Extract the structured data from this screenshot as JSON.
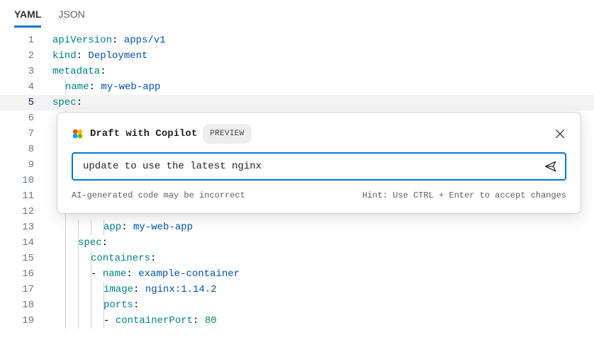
{
  "tabs": {
    "yaml": "YAML",
    "json": "JSON"
  },
  "editor": {
    "lines": [
      {
        "n": "1",
        "tokens": [
          {
            "t": "apiVersion",
            "c": "key"
          },
          {
            "t": ": ",
            "c": "punc"
          },
          {
            "t": "apps/v1",
            "c": "val"
          }
        ],
        "indent": 0
      },
      {
        "n": "2",
        "tokens": [
          {
            "t": "kind",
            "c": "key"
          },
          {
            "t": ": ",
            "c": "punc"
          },
          {
            "t": "Deployment",
            "c": "val"
          }
        ],
        "indent": 0
      },
      {
        "n": "3",
        "tokens": [
          {
            "t": "metadata",
            "c": "key"
          },
          {
            "t": ":",
            "c": "punc"
          }
        ],
        "indent": 0
      },
      {
        "n": "4",
        "tokens": [
          {
            "t": "name",
            "c": "key"
          },
          {
            "t": ": ",
            "c": "punc"
          },
          {
            "t": "my-web-app",
            "c": "val"
          }
        ],
        "indent": 1
      },
      {
        "n": "5",
        "tokens": [
          {
            "t": "spec",
            "c": "key"
          },
          {
            "t": ":",
            "c": "punc"
          }
        ],
        "indent": 0,
        "current": true
      },
      {
        "n": "6",
        "tokens": [],
        "indent": 1
      },
      {
        "n": "7",
        "tokens": [],
        "indent": 1
      },
      {
        "n": "8",
        "tokens": [],
        "indent": 1
      },
      {
        "n": "9",
        "tokens": [],
        "indent": 1
      },
      {
        "n": "10",
        "tokens": [],
        "indent": 1
      },
      {
        "n": "11",
        "tokens": [],
        "indent": 1
      },
      {
        "n": "12",
        "tokens": [],
        "indent": 1
      },
      {
        "n": "13",
        "tokens": [
          {
            "t": "app",
            "c": "key"
          },
          {
            "t": ": ",
            "c": "punc"
          },
          {
            "t": "my-web-app",
            "c": "val"
          }
        ],
        "indent": 4
      },
      {
        "n": "14",
        "tokens": [
          {
            "t": "spec",
            "c": "key"
          },
          {
            "t": ":",
            "c": "punc"
          }
        ],
        "indent": 2
      },
      {
        "n": "15",
        "tokens": [
          {
            "t": "containers",
            "c": "key"
          },
          {
            "t": ":",
            "c": "punc"
          }
        ],
        "indent": 3
      },
      {
        "n": "16",
        "tokens": [
          {
            "t": "- ",
            "c": "punc"
          },
          {
            "t": "name",
            "c": "key"
          },
          {
            "t": ": ",
            "c": "punc"
          },
          {
            "t": "example-container",
            "c": "val"
          }
        ],
        "indent": 3
      },
      {
        "n": "17",
        "tokens": [
          {
            "t": "image",
            "c": "key"
          },
          {
            "t": ": ",
            "c": "punc"
          },
          {
            "t": "nginx:1.14.2",
            "c": "val"
          }
        ],
        "indent": 4
      },
      {
        "n": "18",
        "tokens": [
          {
            "t": "ports",
            "c": "key"
          },
          {
            "t": ":",
            "c": "punc"
          }
        ],
        "indent": 4
      },
      {
        "n": "19",
        "tokens": [
          {
            "t": "- ",
            "c": "punc"
          },
          {
            "t": "containerPort",
            "c": "key"
          },
          {
            "t": ": ",
            "c": "punc"
          },
          {
            "t": "80",
            "c": "num"
          }
        ],
        "indent": 4
      }
    ]
  },
  "popup": {
    "title": "Draft with Copilot",
    "badge": "PREVIEW",
    "prompt": "update to use the latest nginx",
    "disclaimer": "AI-generated code may be incorrect",
    "hint": "Hint: Use CTRL + Enter to accept changes"
  }
}
